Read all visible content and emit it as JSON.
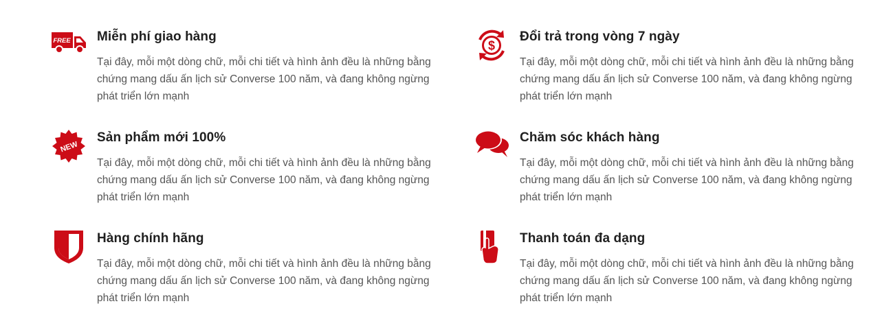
{
  "brand_color": "#cc0c17",
  "features": [
    {
      "icon": "free-delivery-truck-icon",
      "icon_text": "FREE",
      "title": "Miễn phí giao hàng",
      "description": "Tại đây, mỗi một dòng chữ, mỗi chi tiết và hình ảnh đều là những bằng chứng mang dấu ấn lịch sử Converse 100 năm, và đang không ngừng phát triển lớn mạnh"
    },
    {
      "icon": "money-return-icon",
      "title": "Đổi trả trong vòng 7 ngày",
      "description": "Tại đây, mỗi một dòng chữ, mỗi chi tiết và hình ảnh đều là những bằng chứng mang dấu ấn lịch sử Converse 100 năm, và đang không ngừng phát triển lớn mạnh"
    },
    {
      "icon": "new-badge-icon",
      "icon_text": "NEW",
      "title": "Sản phẩm mới 100%",
      "description": "Tại đây, mỗi một dòng chữ, mỗi chi tiết và hình ảnh đều là những bằng chứng mang dấu ấn lịch sử Converse 100 năm, và đang không ngừng phát triển lớn mạnh"
    },
    {
      "icon": "chat-bubbles-icon",
      "title": "Chăm sóc khách hàng",
      "description": "Tại đây, mỗi một dòng chữ, mỗi chi tiết và hình ảnh đều là những bằng chứng mang dấu ấn lịch sử Converse 100 năm, và đang không ngừng phát triển lớn mạnh"
    },
    {
      "icon": "shield-icon",
      "title": "Hàng chính hãng",
      "description": "Tại đây, mỗi một dòng chữ, mỗi chi tiết và hình ảnh đều là những bằng chứng mang dấu ấn lịch sử Converse 100 năm, và đang không ngừng phát triển lớn mạnh"
    },
    {
      "icon": "card-payment-icon",
      "title": "Thanh toán đa dạng",
      "description": "Tại đây, mỗi một dòng chữ, mỗi chi tiết và hình ảnh đều là những bằng chứng mang dấu ấn lịch sử Converse 100 năm, và đang không ngừng phát triển lớn mạnh"
    }
  ]
}
